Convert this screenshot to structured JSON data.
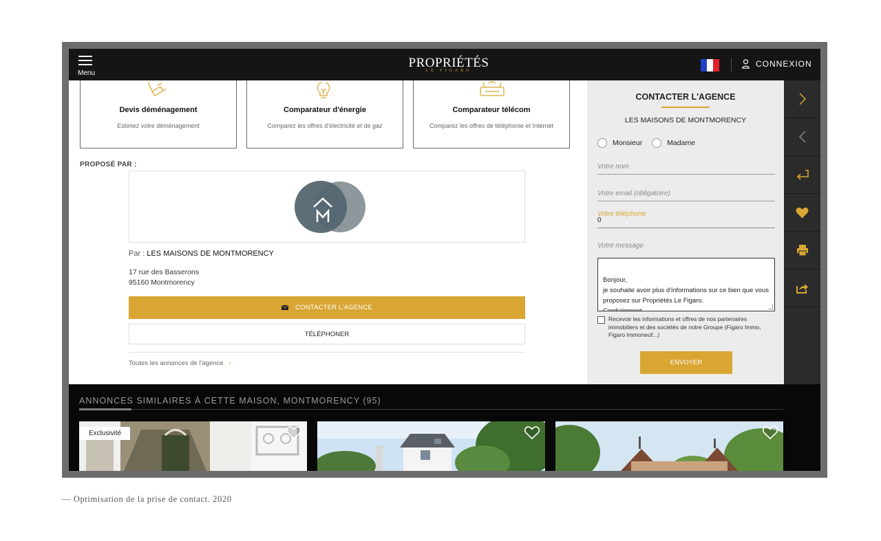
{
  "header": {
    "menu_label": "Menu",
    "logo_main": "PROPRIÉTÉS",
    "logo_sub": "LE FIGARO",
    "login_label": "CONNEXION",
    "flag_colors": [
      "#1f3fc4",
      "#ffffff",
      "#e5202b"
    ]
  },
  "services": [
    {
      "title": "Devis déménagement",
      "description": "Estimez votre déménagement",
      "icon": "moving-box-icon"
    },
    {
      "title": "Comparateur d'énergie",
      "description": "Comparez les offres d'électricité et de gaz",
      "icon": "lightbulb-icon"
    },
    {
      "title": "Comparateur télécom",
      "description": "Comparez les offres de téléphonie et Internet",
      "icon": "router-icon"
    }
  ],
  "agency": {
    "section_label": "PROPOSÉ PAR :",
    "by_prefix": "Par : ",
    "name": "LES MAISONS DE MONTMORENCY",
    "address_line1": "17 rue des Basserons",
    "address_line2": "95160 Montmorency",
    "contact_button": "CONTACTER L'AGENCE",
    "phone_button": "TÉLÉPHONER",
    "all_ads_link": "Toutes les annonces de l'agence",
    "chevron": "›"
  },
  "contact_form": {
    "title": "CONTACTER L'AGENCE",
    "agency_name": "LES MAISONS DE MONTMORENCY",
    "civility_options": [
      "Monsieur",
      "Madame"
    ],
    "name_placeholder": "Votre nom",
    "email_placeholder": "Votre email (obligatoire)",
    "phone_label": "Votre téléphone",
    "phone_value": "0",
    "message_label": "Votre message",
    "message_value": "Bonjour,\nje souhaite avoir plus d'informations sur ce bien que vous proposez sur Propriétés Le Figaro.\nCordialement.",
    "consent_text": "Recevoir les informations et offres de nos partenaires immobiliers et des sociétés de notre Groupe (Figaro Immo, Figaro Immoneuf...)",
    "submit_label": "ENVOYER"
  },
  "toolbar": {
    "items": [
      "chevron-right-icon",
      "chevron-left-icon",
      "return-icon",
      "heart-icon",
      "print-icon",
      "share-icon"
    ]
  },
  "similar": {
    "title": "ANNONCES SIMILAIRES À CETTE MAISON, MONTMORENCY (95)",
    "badge": "Exclusivité"
  },
  "caption": "— Optimisation de la prise de contact. 2020",
  "colors": {
    "accent": "#d9a633",
    "header_bg": "#151515",
    "panel_bg": "#ececec",
    "toolbar_bg": "#2b2b2b"
  }
}
